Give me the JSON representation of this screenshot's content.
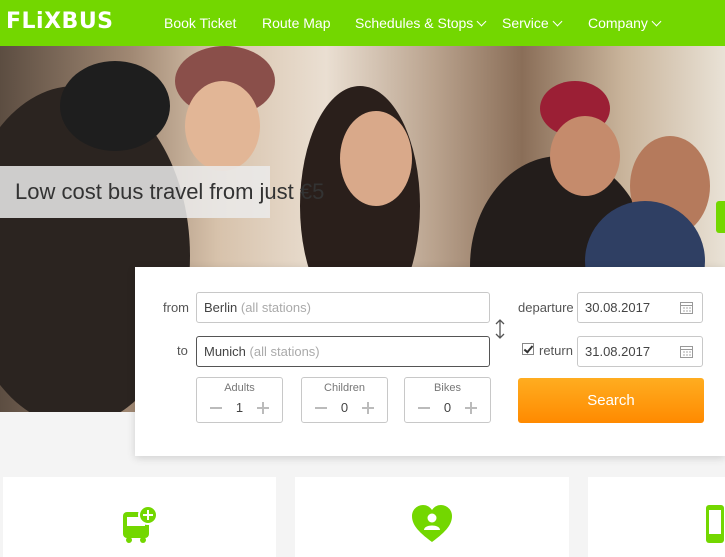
{
  "brand": {
    "logo": "FLiXBUS",
    "accent": "#73d700",
    "button_color": "#ff9500"
  },
  "nav": {
    "items": [
      {
        "label": "Book Ticket",
        "dropdown": false
      },
      {
        "label": "Route Map",
        "dropdown": false
      },
      {
        "label": "Schedules & Stops",
        "dropdown": true
      },
      {
        "label": "Service",
        "dropdown": true
      },
      {
        "label": "Company",
        "dropdown": true
      }
    ]
  },
  "hero": {
    "headline": "Low cost bus travel from just €5"
  },
  "search": {
    "from_label": "from",
    "from_city": "Berlin",
    "from_suffix": "(all stations)",
    "to_label": "to",
    "to_city": "Munich",
    "to_suffix": "(all stations)",
    "departure_label": "departure",
    "departure_date": "30.08.2017",
    "return_label": "return",
    "return_checked": true,
    "return_date": "31.08.2017",
    "adults_label": "Adults",
    "adults_value": "1",
    "children_label": "Children",
    "children_value": "0",
    "bikes_label": "Bikes",
    "bikes_value": "0",
    "search_button": "Search"
  },
  "cards": [
    {
      "icon": "bus-add-icon"
    },
    {
      "icon": "heart-user-icon"
    },
    {
      "icon": "mobile-icon"
    }
  ]
}
